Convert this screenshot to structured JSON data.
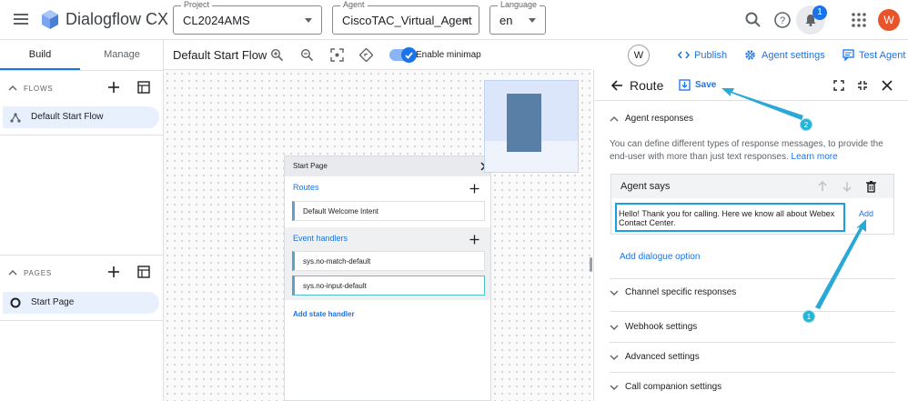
{
  "app": {
    "title": "Dialogflow CX",
    "project": {
      "label": "Project",
      "value": "CL2024AMS"
    },
    "agent": {
      "label": "Agent",
      "value": "CiscoTAC_Virtual_Agent"
    },
    "language": {
      "label": "Language",
      "value": "en"
    },
    "notification_count": "1",
    "user_initial": "W"
  },
  "sidebar": {
    "tabs": [
      "Build",
      "Manage"
    ],
    "flows_title": "FLOWS",
    "flows": [
      {
        "label": "Default Start Flow"
      }
    ],
    "pages_title": "PAGES",
    "pages": [
      {
        "label": "Start Page"
      }
    ]
  },
  "flowbar": {
    "title": "Default Start Flow",
    "minimap_label": "Enable minimap",
    "minimap_enabled": true
  },
  "page_card": {
    "title": "Start Page",
    "routes_label": "Routes",
    "routes": [
      "Default Welcome Intent"
    ],
    "event_handlers_label": "Event handlers",
    "event_handlers": [
      "sys.no-match-default",
      "sys.no-input-default"
    ],
    "add_state_handler": "Add state handler"
  },
  "right_header": {
    "avatar": "W",
    "publish": "Publish",
    "agent_settings": "Agent settings",
    "test_agent": "Test Agent"
  },
  "route_panel": {
    "title": "Route",
    "save": "Save",
    "agent_responses": "Agent responses",
    "description": "You can define different types of response messages, to provide the end-user with more than just text responses.",
    "learn_more": "Learn more",
    "agent_says": "Agent says",
    "message": "Hello! Thank you for calling. Here we know all about Webex Contact Center.",
    "add": "Add",
    "add_dialogue": "Add dialogue option",
    "sections": [
      "Channel specific responses",
      "Webhook settings",
      "Advanced settings",
      "Call companion settings"
    ]
  },
  "callouts": [
    "1",
    "2"
  ],
  "colors": {
    "accent": "#1a73e8",
    "callout": "#25b4d6",
    "avatar": "#e8552b"
  }
}
